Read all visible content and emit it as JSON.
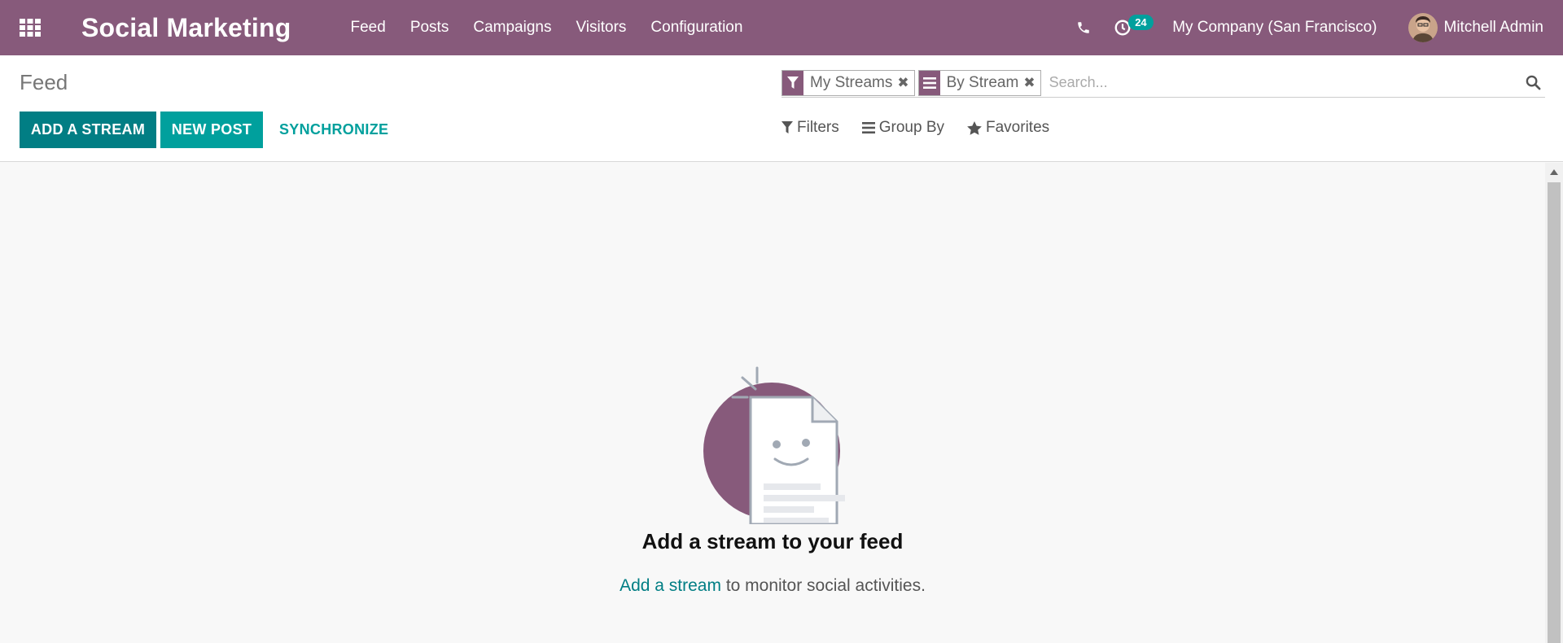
{
  "navbar": {
    "app_title": "Social Marketing",
    "menu": [
      "Feed",
      "Posts",
      "Campaigns",
      "Visitors",
      "Configuration"
    ],
    "activity_count": "24",
    "company": "My Company (San Francisco)",
    "user": "Mitchell Admin",
    "colors": {
      "background": "#875a7b",
      "badge": "#00a09d"
    }
  },
  "control_panel": {
    "breadcrumb": "Feed",
    "buttons": {
      "add_stream": "ADD A STREAM",
      "new_post": "NEW POST",
      "synchronize": "SYNCHRONIZE"
    },
    "search": {
      "facets": [
        {
          "icon": "filter-icon",
          "label": "My Streams"
        },
        {
          "icon": "group-by-icon",
          "label": "By Stream"
        }
      ],
      "placeholder": "Search..."
    },
    "search_options": {
      "filters": "Filters",
      "group_by": "Group By",
      "favorites": "Favorites"
    }
  },
  "empty_state": {
    "title": "Add a stream to your feed",
    "link_text": "Add a stream",
    "text_after_link": " to monitor social activities."
  }
}
